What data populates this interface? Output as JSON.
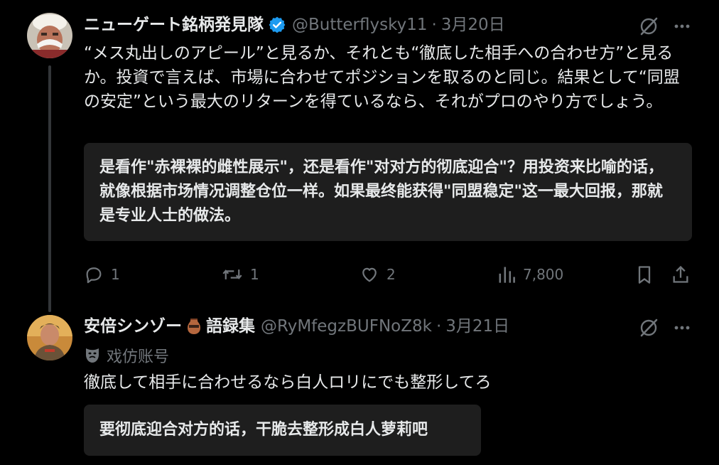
{
  "tweet1": {
    "author_name": "ニューゲート銘柄発見隊",
    "handle": "@Butterflysky11",
    "separator": "·",
    "date": "3月20日",
    "text": "“メス丸出しのアピール”と見るか、それとも“徹底した相手への合わせ方”と見るか。投資で言えば、市場に合わせてポジションを取るのと同じ。結果として“同盟の安定”という最大のリターンを得ているなら、それがプロのやり方でしょう。",
    "translation": "是看作\"赤裸裸的雌性展示\"，还是看作\"对对方的彻底迎合\"？用投资来比喻的话，就像根据市场情况调整仓位一样。如果最终能获得\"同盟稳定\"这一最大回报，那就是专业人士的做法。",
    "replies": "1",
    "reposts": "1",
    "likes": "2",
    "views": "7,800"
  },
  "tweet2": {
    "author_name": "安倍シンゾー",
    "author_suffix": "語録集",
    "handle": "@RyMfegzBUFNoZ8k",
    "separator": "·",
    "date": "3月21日",
    "parody_label": "戏仿账号",
    "text": "徹底して相手に合わせるなら白人ロリにでも整形してろ",
    "translation": "要彻底迎合对方的话，干脆去整形成白人萝莉吧"
  },
  "colors": {
    "background": "#000000",
    "text": "#e7e9ea",
    "muted": "#71767b",
    "verified_blue": "#1d9bf0",
    "translation_box": "#1e1e1e"
  }
}
